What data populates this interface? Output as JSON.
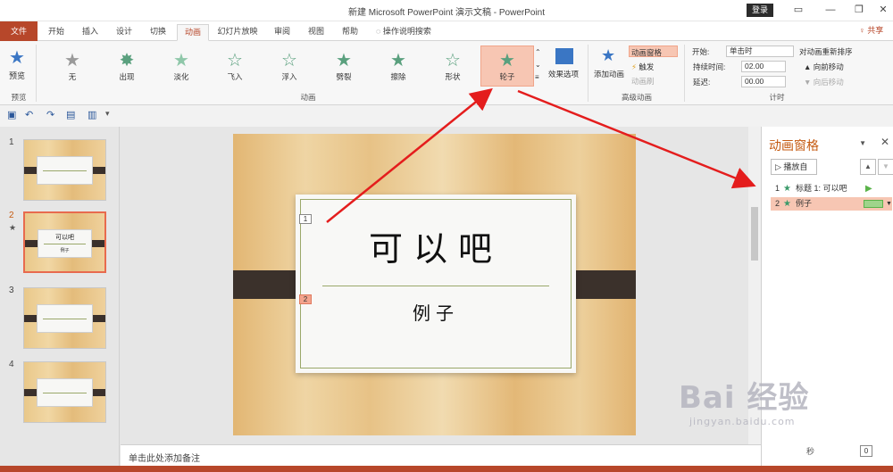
{
  "window": {
    "title": "新建 Microsoft PowerPoint 演示文稿 - PowerPoint",
    "login": "登录",
    "btn_restore_icon": "▭",
    "btn_min": "—",
    "btn_max": "❐",
    "btn_close": "✕"
  },
  "tabs": [
    {
      "label": "文件"
    },
    {
      "label": "开始"
    },
    {
      "label": "插入"
    },
    {
      "label": "设计"
    },
    {
      "label": "切换"
    },
    {
      "label": "动画"
    },
    {
      "label": "幻灯片放映"
    },
    {
      "label": "审阅"
    },
    {
      "label": "视图"
    },
    {
      "label": "帮助"
    },
    {
      "label": "操作说明搜索"
    }
  ],
  "share": "♀ 共享",
  "ribbon": {
    "preview": {
      "label": "预览",
      "group": "预览"
    },
    "animations": {
      "group": "动画",
      "items": [
        "无",
        "出现",
        "淡化",
        "飞入",
        "浮入",
        "劈裂",
        "擦除",
        "形状",
        "轮子"
      ],
      "effect_options": "效果选项"
    },
    "advanced": {
      "group": "高级动画",
      "add_animation": "添加动画",
      "pane": "动画窗格",
      "trigger": "触发",
      "painter": "动画刷"
    },
    "timing": {
      "group": "计时",
      "start_label": "开始:",
      "start_value": "单击时",
      "duration_label": "持续时间:",
      "duration_value": "02.00",
      "delay_label": "延迟:",
      "delay_value": "00.00",
      "reorder_title": "对动画重新排序",
      "move_earlier": "向前移动",
      "move_later": "向后移动"
    }
  },
  "slides": [
    {
      "num": "1",
      "title": "",
      "subtitle": ""
    },
    {
      "num": "2",
      "title": "可以吧",
      "subtitle": "例子"
    },
    {
      "num": "3",
      "title": "",
      "subtitle": ""
    },
    {
      "num": "4",
      "title": "",
      "subtitle": ""
    }
  ],
  "slide_marker": "★",
  "current_slide": {
    "title": "可以吧",
    "subtitle": "例子",
    "tag1": "1",
    "tag2": "2"
  },
  "notes_placeholder": "单击此处添加备注",
  "anim_pane": {
    "title": "动画窗格",
    "play_from": "▷ 播放自",
    "items": [
      {
        "num": "1",
        "name": "标题 1: 可以吧"
      },
      {
        "num": "2",
        "name": "例子"
      }
    ],
    "seconds_label": "秒",
    "page_value": "0"
  },
  "watermark": {
    "brand": "Bai 经验",
    "site": "jingyan.baidu.com"
  },
  "colors": {
    "accent": "#b7472a",
    "selection": "#f7c6b3",
    "anim_star": "#5aa07e"
  }
}
